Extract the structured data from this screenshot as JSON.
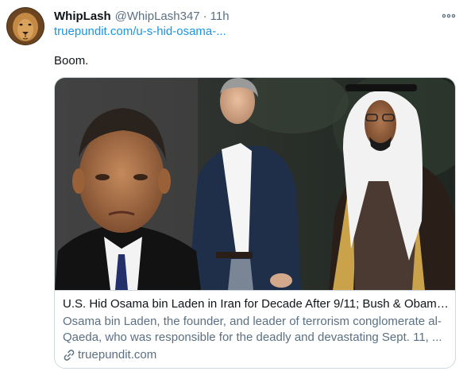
{
  "tweet": {
    "author_name": "WhipLash",
    "author_handle": "@WhipLash347",
    "separator": "·",
    "time": "11h",
    "link_text": "truepundit.com/u-s-hid-osama-...",
    "text": "Boom."
  },
  "card": {
    "title": "U.S. Hid Osama bin Laden in Iran for Decade After 9/11; Bush & Obama ...",
    "description": "Osama bin Laden, the founder, and leader of terrorism conglomerate al-Qaeda, who was responsible for the deadly and devastating Sept. 11, ...",
    "domain": "truepundit.com"
  },
  "icons": {
    "more": "more-horizontal-icon",
    "link": "link-icon",
    "avatar": "lion-avatar"
  },
  "colors": {
    "link": "#1b95e0",
    "secondary_text": "#5b7083",
    "primary_text": "#0f1419",
    "border": "#cfd9de"
  }
}
